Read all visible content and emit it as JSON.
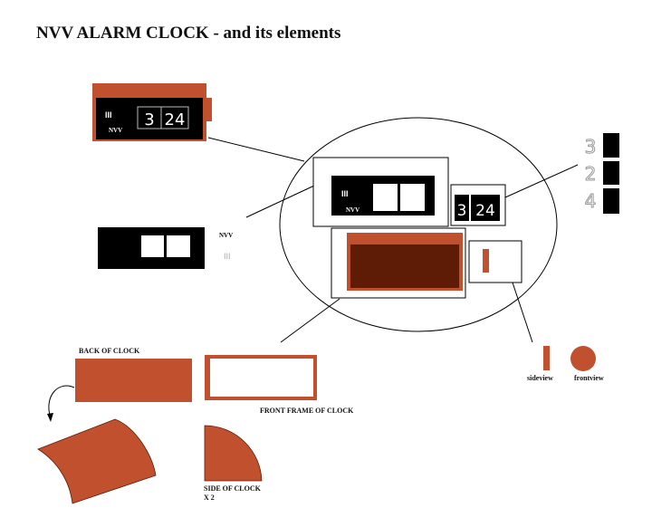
{
  "title": "NVV ALARM CLOCK - and its elements",
  "clock": {
    "brand": "NVV",
    "symbol": "III",
    "hour": "3",
    "minutes": "24"
  },
  "digit_cards": [
    "3",
    "2",
    "4"
  ],
  "labels": {
    "back_of_clock": "BACK OF CLOCK",
    "front_frame": "FRONT FRAME OF CLOCK",
    "side_of_clock": "SIDE OF CLOCK",
    "side_count": "X 2",
    "sideview": "sideview",
    "frontview": "frontview"
  },
  "colors": {
    "rust": "#c0502e",
    "dark_rust": "#5e1c06",
    "black": "#000000",
    "gray_digit": "#9a9a9a",
    "white": "#ffffff"
  }
}
